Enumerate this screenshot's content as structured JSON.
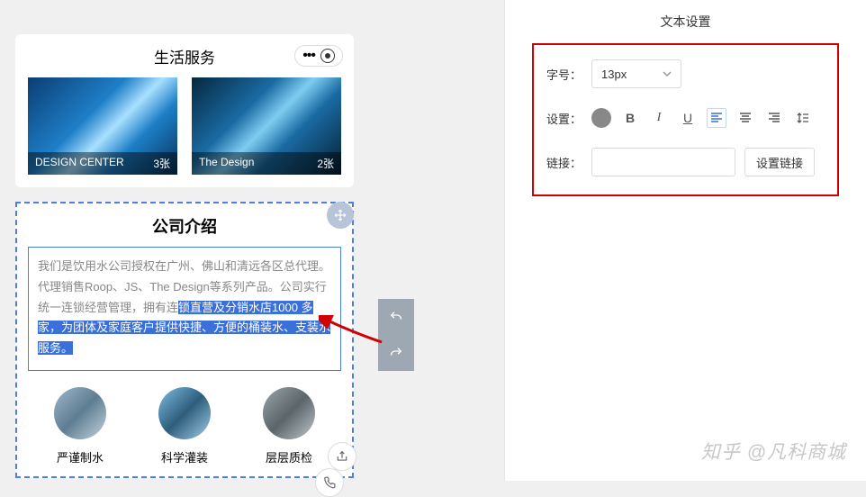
{
  "phone": {
    "title": "生活服务",
    "tiles": [
      {
        "label": "DESIGN CENTER",
        "count": "3张"
      },
      {
        "label": "The Design",
        "count": "2张"
      }
    ]
  },
  "section": {
    "title": "公司介绍",
    "text_plain": "我们是饮用水公司授权在广州、佛山和清远各区总代理。代理销售Roop、JS、The Design等系列产品。公司实行统一连锁经营管理，拥有连",
    "text_highlight": "锁直营及分销水店1000 多家，为团体及家庭客户提供快捷、方便的桶装水、支装水服务。",
    "circles": [
      {
        "label": "严谨制水"
      },
      {
        "label": "科学灌装"
      },
      {
        "label": "层层质检"
      }
    ]
  },
  "panel": {
    "title": "文本设置",
    "font_label": "字号：",
    "font_value": "13px",
    "setting_label": "设置：",
    "link_label": "链接：",
    "link_value": "",
    "link_button": "设置链接"
  },
  "watermark": "知乎 @凡科商城"
}
